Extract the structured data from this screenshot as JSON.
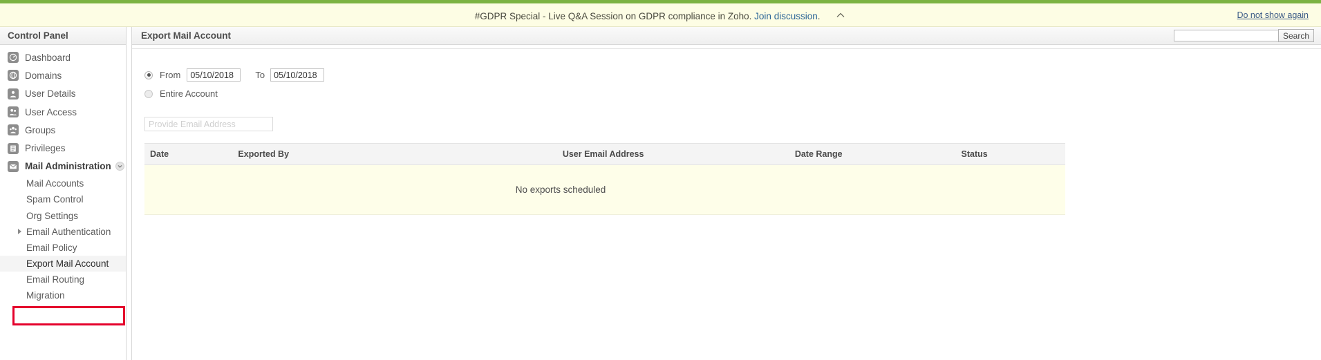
{
  "banner": {
    "text_before_link": "#GDPR Special - Live Q&A Session on GDPR compliance in Zoho. ",
    "link_label": "Join discussion",
    "text_after_link": ".",
    "dismiss_label": "Do not show again",
    "collapse_icon": "chevron-up-icon",
    "background": "#fdfde4"
  },
  "top_strip": {
    "color": "#7cb342"
  },
  "sidebar": {
    "title": "Control Panel",
    "items": [
      {
        "label": "Dashboard",
        "icon": "dashboard-icon"
      },
      {
        "label": "Domains",
        "icon": "globe-icon"
      },
      {
        "label": "User Details",
        "icon": "user-icon"
      },
      {
        "label": "User Access",
        "icon": "user-access-icon"
      },
      {
        "label": "Groups",
        "icon": "groups-icon"
      },
      {
        "label": "Privileges",
        "icon": "document-icon"
      },
      {
        "label": "Mail Administration",
        "icon": "envelope-icon",
        "active": true,
        "caret_icon": "chevron-down-icon"
      }
    ],
    "subitems": [
      {
        "label": "Mail Accounts"
      },
      {
        "label": "Spam Control"
      },
      {
        "label": "Org Settings"
      },
      {
        "label": "Email Authentication",
        "has_arrow": true
      },
      {
        "label": "Email Policy"
      },
      {
        "label": "Export Mail Account",
        "selected": true,
        "highlight_color": "#e4002b"
      },
      {
        "label": "Email Routing"
      },
      {
        "label": "Migration"
      }
    ]
  },
  "main": {
    "title": "Export Mail Account",
    "search": {
      "value": "",
      "placeholder": "",
      "button_label": "Search"
    },
    "form": {
      "range_option": {
        "label": "From",
        "selected": true,
        "from_value": "05/10/2018",
        "to_label": "To",
        "to_value": "05/10/2018"
      },
      "entire_account_option": {
        "label": "Entire Account",
        "selected": false
      },
      "email_field": {
        "value": "",
        "placeholder": "Provide Email Address"
      }
    },
    "table": {
      "columns": [
        "Date",
        "Exported By",
        "User Email Address",
        "Date Range",
        "Status"
      ],
      "rows": [],
      "empty_message": "No exports scheduled"
    }
  }
}
